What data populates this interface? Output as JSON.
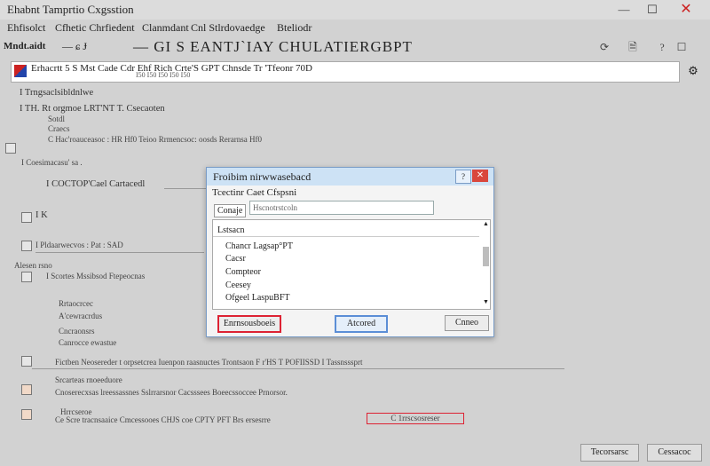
{
  "window": {
    "title": "Ehabnt  Tamprtio Cxgsstion",
    "minimize_glyph": "—",
    "maximize_glyph": "☐",
    "close_glyph": "✕"
  },
  "subheader": {
    "parts": [
      "Ehfisolct",
      "Cfhetic Chrfiedent",
      "Clanmdant",
      "Cnl Stlrdovaedge",
      "Bteliodr"
    ]
  },
  "toolbar": {
    "left_label": "Mndt.aidt",
    "mid_glyph": "—  ɕ  Ɉ",
    "title": "— GI S EANTJ`IAY CHULATIERGBPT",
    "icons": [
      "refresh-icon",
      "document-icon",
      "help-icon"
    ],
    "icon_glyphs": [
      "⟳",
      "🗎",
      "?"
    ],
    "checkbox_glyph": "☐"
  },
  "searchbar": {
    "text": "Erhacrtt 5  S Mst Cade  Cdr   Ehf   Rich    Crte'S  GPT    Chnsde  Tr 'Tfeonr 70D",
    "subtext": "I50                    I50          I50          I50          I50",
    "settings_glyph": "⚙"
  },
  "content": {
    "rows": [
      "I   Trngsaclsibldnlwe",
      "I  TH. Rt  orgmoe LRT'NT T. Csecaoten",
      "Sotdl",
      "Craecs",
      "C  Hac'roauceasoc :  HR   Hf0  Teioo  Rrmencsoc: oosds  Rerarnsa  Hf0",
      "I  Coesimacasu' sa   .",
      "I   COCTOP'Cael  Cartacedl",
      "I    K",
      "I   Pldaarwecvos  :   Pat :  SAD",
      "Alesen  rsno",
      "I    Scortes  Mssibsod  Ftepeocnas",
      "Rrtaocrcec",
      "A'cewracrdus",
      "Cncraonsrs",
      "Canrocce  ewastue",
      "Fictben  Neosereder  t   orpsetcrea  Iuenpon  raasnuctes  Trontsaon   F   r'HS  T   POFIISSD  I   Tassnsssprt",
      "Srcarteas  rnoeeduore",
      "Cnoserecxsas  lreessassnes  Sslrrarsnor  Cacsssees  Boeecssoccee  Prnorsor.",
      "Hrrcseroe",
      "Ce  Scre  tracnsaaice  Cmcessooes  CHJS  coe  CPTY  PFT   Brs  ersesrre"
    ],
    "highlighted_row_tail": "C  1rrscsosreser"
  },
  "dialog": {
    "title": "Froibim nirwwasebacd",
    "help_glyph": "?",
    "close_glyph": "✕",
    "subtitle": "Tcectinr Caet  Cfspsni",
    "field_label": "Conaje",
    "input_placeholder": "Hscnotrstcoln",
    "list_header": "Lstsacn",
    "list_items": [
      "Chancr Lagsap°PT",
      "Cacsr",
      "Compteor",
      "Ceesey",
      "Ofgeel LaspuBFT"
    ],
    "scroll_up_glyph": "▲",
    "scroll_down_glyph": "▼",
    "buttons": {
      "left": "Enrnsousboeis",
      "middle": "Atcored",
      "right": "Cnneo"
    }
  },
  "footer": {
    "buttons": [
      "Tecorsarsc",
      "Cessacoc"
    ]
  },
  "colors": {
    "dialog_border": "#7a9cc6",
    "highlight_red": "#d23",
    "focus_blue": "#5b8ed6"
  }
}
